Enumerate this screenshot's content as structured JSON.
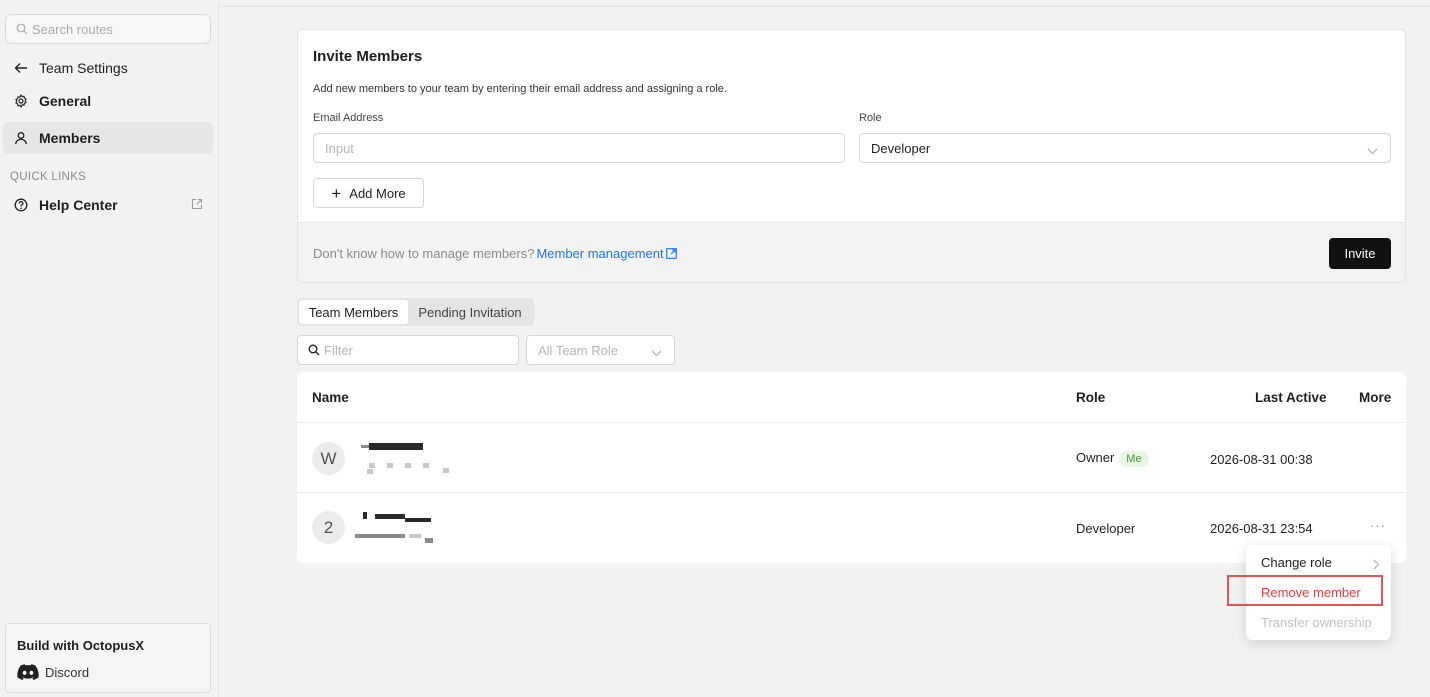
{
  "sidebar": {
    "search_placeholder": "Search routes",
    "back_label": "Team Settings",
    "items": [
      {
        "label": "General",
        "icon": "gear-icon"
      },
      {
        "label": "Members",
        "icon": "user-icon"
      }
    ],
    "quick_links_heading": "QUICK LINKS",
    "help_center_label": "Help Center",
    "build_title": "Build with OctopusX",
    "discord_label": "Discord"
  },
  "invite": {
    "title": "Invite Members",
    "description": "Add new members to your team by entering their email address and assigning a role.",
    "email_label": "Email Address",
    "email_placeholder": "Input",
    "role_label": "Role",
    "role_value": "Developer",
    "add_more_label": "Add More",
    "help_text": "Don't know how to manage members?",
    "help_link": "Member management",
    "invite_button": "Invite"
  },
  "tabs": [
    {
      "label": "Team Members",
      "active": true
    },
    {
      "label": "Pending Invitation",
      "active": false
    }
  ],
  "filters": {
    "filter_placeholder": "Filter",
    "role_filter_placeholder": "All Team Role"
  },
  "table": {
    "columns": [
      "Name",
      "Role",
      "Last Active",
      "More"
    ],
    "rows": [
      {
        "avatar": "W",
        "role": "Owner",
        "badge": "Me",
        "last_active": "2026-08-31 00:38",
        "more": ""
      },
      {
        "avatar": "2",
        "role": "Developer",
        "badge": "",
        "last_active": "2026-08-31 23:54",
        "more": "···"
      }
    ]
  },
  "context_menu": {
    "items": [
      "Change role",
      "Remove member",
      "Transfer ownership"
    ]
  },
  "colors": {
    "accent_link": "#1677ff",
    "danger": "#e23c3c",
    "badge_green": "#3e9a36",
    "primary_button": "#111111"
  }
}
